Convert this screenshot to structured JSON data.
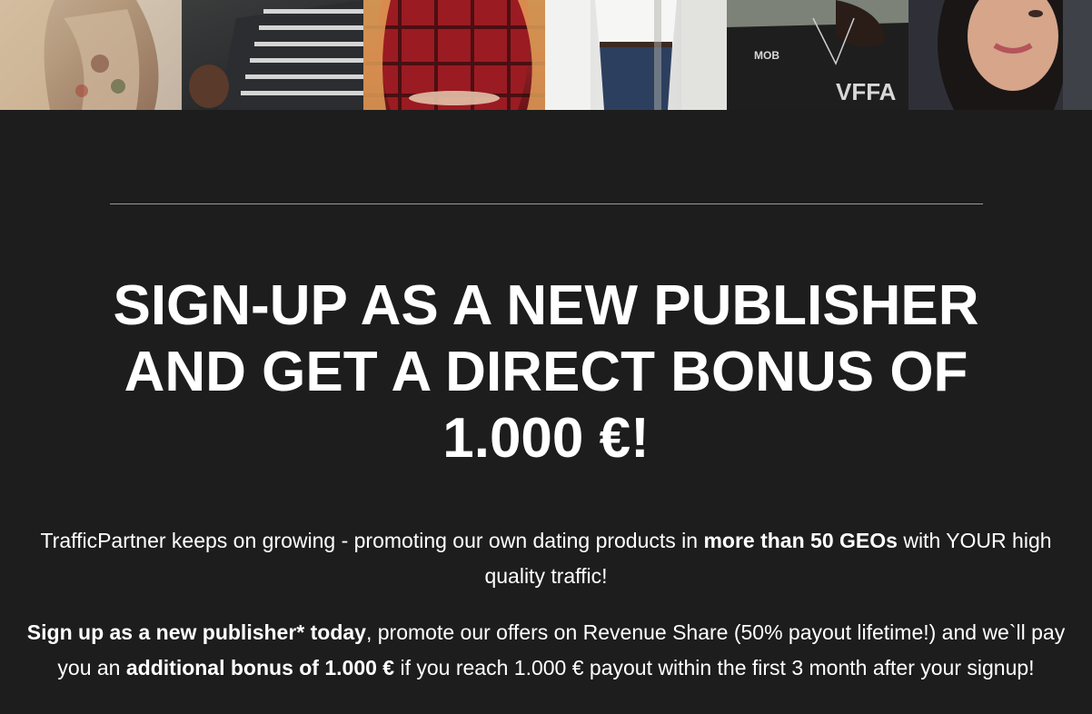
{
  "photo_strip": {
    "photos": [
      {
        "name": "woman in patterned blouse"
      },
      {
        "name": "man in striped sweater"
      },
      {
        "name": "woman in red plaid shirt"
      },
      {
        "name": "person in white shirt and jeans"
      },
      {
        "name": "man in black graphic tee"
      },
      {
        "name": "woman smiling portrait"
      }
    ]
  },
  "headline": {
    "line1": "SIGN-UP AS A NEW PUBLISHER",
    "line2": "AND GET A DIRECT BONUS OF",
    "line3": "1.000 €!"
  },
  "paragraph1": {
    "text_a": "TrafficPartner keeps on growing - promoting our own dating products in ",
    "bold_a": "more than 50 GEOs",
    "text_b": " with YOUR high quality traffic!"
  },
  "paragraph2": {
    "bold_a": "Sign up as a new publisher* today",
    "text_a": ", promote our offers on Revenue Share (50% payout lifetime!) and we`ll pay you an ",
    "bold_b": "additional bonus of 1.000 €",
    "text_b": " if you reach 1.000 € payout within the first 3 month after your signup!"
  },
  "colors": {
    "background": "#1d1d1d",
    "text": "#ffffff",
    "divider": "#9a9a9a"
  }
}
